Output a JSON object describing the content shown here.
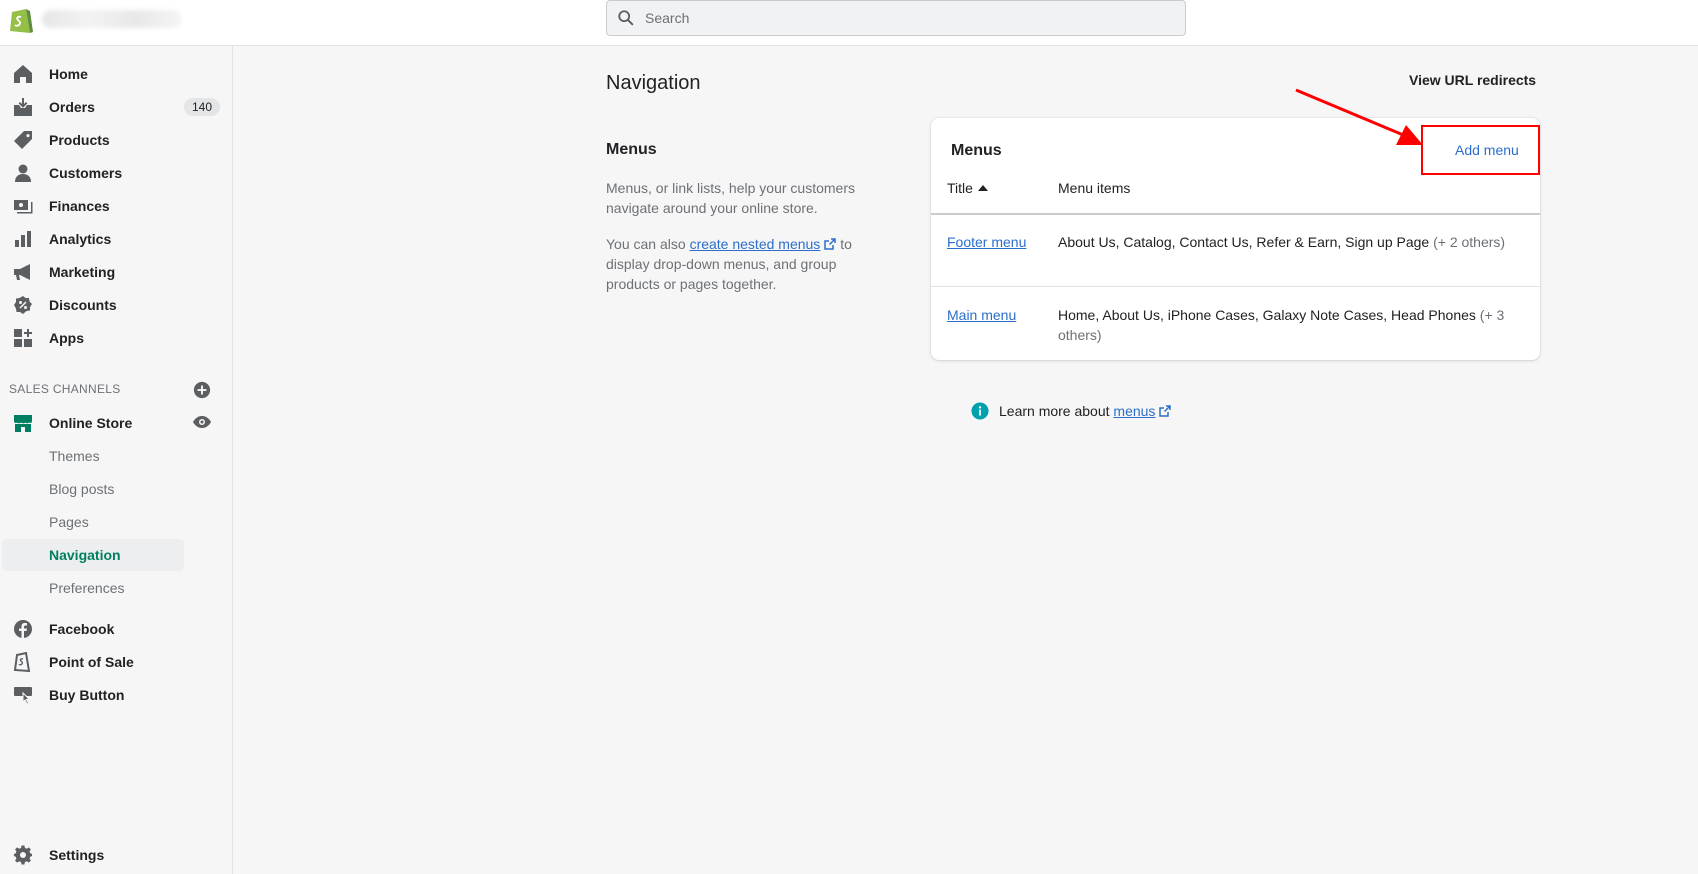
{
  "search": {
    "placeholder": "Search"
  },
  "sidebar": {
    "items": [
      {
        "label": "Home",
        "icon": "home-icon"
      },
      {
        "label": "Orders",
        "icon": "orders-icon",
        "badge": "140"
      },
      {
        "label": "Products",
        "icon": "tag-icon"
      },
      {
        "label": "Customers",
        "icon": "person-icon"
      },
      {
        "label": "Finances",
        "icon": "finances-icon"
      },
      {
        "label": "Analytics",
        "icon": "bar-chart-icon"
      },
      {
        "label": "Marketing",
        "icon": "megaphone-icon"
      },
      {
        "label": "Discounts",
        "icon": "discount-icon"
      },
      {
        "label": "Apps",
        "icon": "apps-icon"
      }
    ],
    "sales_channels_label": "SALES CHANNELS",
    "online_store": {
      "label": "Online Store",
      "icon": "store-icon"
    },
    "sub_items": [
      "Themes",
      "Blog posts",
      "Pages",
      "Navigation",
      "Preferences"
    ],
    "active_sub_item": "Navigation",
    "channels": [
      {
        "label": "Facebook",
        "icon": "facebook-icon"
      },
      {
        "label": "Point of Sale",
        "icon": "pos-icon"
      },
      {
        "label": "Buy Button",
        "icon": "buy-button-icon"
      }
    ],
    "settings": {
      "label": "Settings",
      "icon": "gear-icon"
    }
  },
  "page": {
    "title": "Navigation",
    "redirects_label": "View URL redirects"
  },
  "menus_section": {
    "title": "Menus",
    "description": "Menus, or link lists, help your customers navigate around your online store.",
    "nested_prefix": "You can also ",
    "nested_link": "create nested menus",
    "nested_suffix": " to display drop-down menus, and group products or pages together."
  },
  "card": {
    "title": "Menus",
    "add_label": "Add menu",
    "col_title": "Title",
    "col_items": "Menu items",
    "rows": [
      {
        "title": "Footer menu",
        "items": "About Us, Catalog, Contact Us, Refer & Earn, Sign up Page",
        "others": "(+ 2 others)"
      },
      {
        "title": "Main menu",
        "items": "Home, About Us, iPhone Cases, Galaxy Note Cases, Head Phones",
        "others": "(+ 3 others)"
      }
    ]
  },
  "learn_more": {
    "prefix": "Learn more about ",
    "link": "menus"
  },
  "colors": {
    "accent": "#008060",
    "link": "#2c6ecb",
    "annotation": "#ff0000"
  }
}
